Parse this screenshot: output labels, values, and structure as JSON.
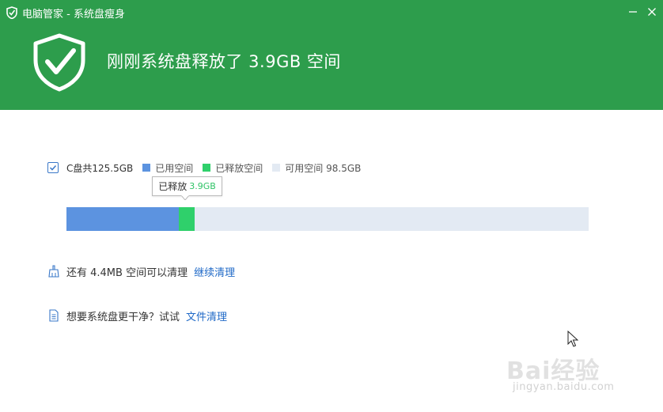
{
  "window": {
    "title": "电脑管家 - 系统盘瘦身",
    "minimize_icon": "minimize-icon",
    "close_icon": "close-icon"
  },
  "header": {
    "headline": "刚刚系统盘释放了 3.9GB 空间",
    "shield_icon": "shield-check-icon",
    "background_color": "#2d9d4c"
  },
  "disk": {
    "summary": "C盘共125.5GB",
    "checked": true,
    "legend": {
      "used_label": "已用空间",
      "freed_label": "已释放空间",
      "free_label": "可用空间 98.5GB"
    },
    "colors": {
      "used": "#5c93e0",
      "freed": "#2fd06b",
      "free": "#e3eaf3"
    },
    "tooltip": {
      "label": "已释放",
      "value": "3.9GB"
    },
    "usage": {
      "total_gb": 125.5,
      "used_fraction": 0.215,
      "freed_fraction": 0.031
    }
  },
  "actions": {
    "line1_text": "还有 4.4MB 空间可以清理",
    "line1_link": "继续清理",
    "line2_text": "想要系统盘更干净？试试",
    "line2_link": "文件清理"
  },
  "watermark": {
    "brand": "Bai经验",
    "url": "jingyan.baidu.com"
  }
}
